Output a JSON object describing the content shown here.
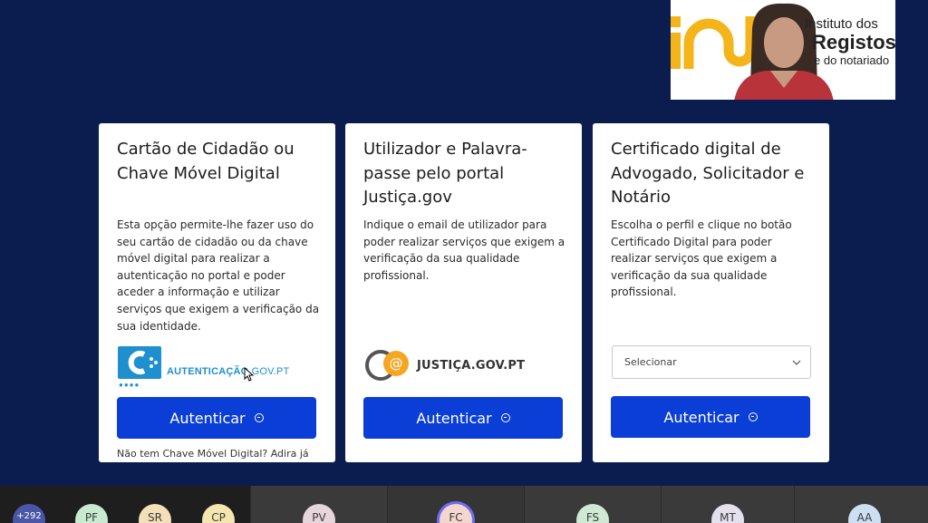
{
  "speaker": {
    "logo_line1": "Instituto dos",
    "logo_line2": "Registos",
    "logo_line3": "e do notariado"
  },
  "cards": [
    {
      "title": "Cartão de Cidadão ou Chave Móvel Digital",
      "description": "Esta opção permite-lhe fazer uso do seu cartão de cidadão ou da chave móvel digital para realizar a autenticação no portal e poder aceder a informação e utilizar serviços que exigem a verificação da sua identidade.",
      "logo_text_bold": "AUTENTICAÇÃO",
      "logo_text_rest": ".GOV.PT",
      "button_label": "Autenticar",
      "footnote": "Não tem Chave Móvel Digital? Adira já"
    },
    {
      "title": "Utilizador e Palavra-passe pelo portal Justiça.gov",
      "description": "Indique o email de utilizador para poder realizar serviços que exigem a verificação da sua qualidade profissional.",
      "logo_text": "JUSTIÇA.GOV.PT",
      "button_label": "Autenticar"
    },
    {
      "title": "Certificado digital de Advogado, Solicitador e Notário",
      "description": "Escolha o perfil e clique no botão Certificado Digital para poder realizar serviços que exigem a verificação da sua qualidade profissional.",
      "select_value": "Selecionar",
      "button_label": "Autenticar"
    }
  ],
  "participants": [
    {
      "initials": "+292",
      "color": "#4a56a6"
    },
    {
      "initials": "PF",
      "color": "#c8ead0"
    },
    {
      "initials": "SR",
      "color": "#f3dfb8"
    },
    {
      "initials": "CP",
      "color": "#f5e6b0"
    },
    {
      "initials": "PV",
      "color": "#e6d6dc"
    },
    {
      "initials": "FC",
      "color": "#f4d6cf"
    },
    {
      "initials": "FS",
      "color": "#cfe9d4"
    },
    {
      "initials": "MT",
      "color": "#e4e0ee"
    },
    {
      "initials": "AA",
      "color": "#cfdff3"
    }
  ]
}
